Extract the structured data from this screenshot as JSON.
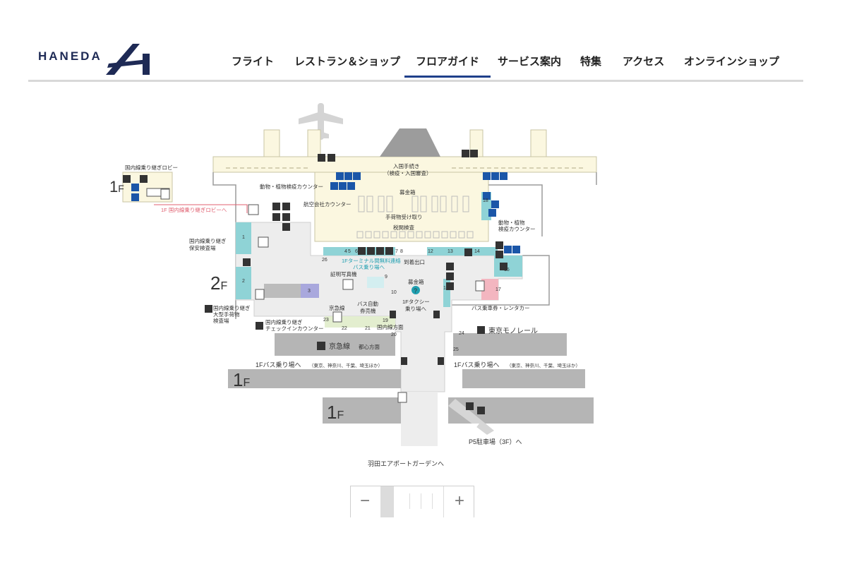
{
  "header": {
    "logo_text": "HANEDA",
    "nav": [
      "フライト",
      "レストラン＆ショップ",
      "フロアガイド",
      "サービス案内",
      "特集",
      "アクセス",
      "オンラインショップ"
    ],
    "active_index": 2
  },
  "map": {
    "floor_labels": {
      "f1_top": "1",
      "f2": "2",
      "f1_left": "1",
      "f1_bottom": "1",
      "suffix": "F"
    },
    "labels": {
      "transfer_lobby": "国内線乗り継ぎロビー",
      "transfer_lobby_link": "1F 国内線乗り継ぎロビーへ",
      "immigration": "入国手続き",
      "immigration_sub": "（検疫・入国審査）",
      "plant_quarantine_left": "動物・植物検疫カウンター",
      "donation_box_top": "募金箱",
      "airline_counter": "航空会社カウンター",
      "baggage_claim": "手荷物受け取り",
      "customs": "税関検査",
      "plant_quarantine_right_1": "動物・植物",
      "plant_quarantine_right_2": "検疫カウンター",
      "transfer_security_1": "国内線乗り継ぎ",
      "transfer_security_2": "保安検査場",
      "bus_connection_1": "1Fターミナル間無料連絡",
      "bus_connection_2": "バス乗り場へ",
      "arrival_exit": "到着出口",
      "id_photo": "証明写真機",
      "donation_box_mid": "募金箱",
      "bus_ticket_1": "バス自動",
      "bus_ticket_2": "券売機",
      "taxi_1": "1Fタクシー",
      "taxi_2": "乗り場へ",
      "bus_rental": "バス乗車券・レンタカー",
      "keikyu_small": "京急線",
      "domestic_direction": "国内線方面",
      "monorail": "東京モノレール",
      "large_baggage_1": "国内線乗り継ぎ",
      "large_baggage_2": "大型手荷物",
      "large_baggage_3": "検査場",
      "checkin_1": "国内線乗り継ぎ",
      "checkin_2": "チェックインカウンター",
      "keikyu": "京急線",
      "city_center": "都心方面",
      "bus_left": "1Fバス乗り場へ",
      "bus_right": "1Fバス乗り場へ",
      "bus_areas": "（東京、神奈川、千葉、埼玉ほか）",
      "parking": "P5駐車場（3F）へ",
      "garden": "羽田エアポートガーデンへ"
    },
    "numbers": [
      "1",
      "2",
      "3",
      "4",
      "5",
      "6",
      "7",
      "8",
      "9",
      "10",
      "12",
      "13",
      "14",
      "15",
      "16",
      "17",
      "18",
      "19",
      "20",
      "21",
      "22",
      "23",
      "24",
      "25",
      "26"
    ]
  },
  "zoom": {
    "minus": "−",
    "plus": "+"
  },
  "colors": {
    "navy": "#1e2a55",
    "accent": "#1f3f8a",
    "teal": "#8fd3d6",
    "pink": "#f3b6c0",
    "purple": "#a9a8dd",
    "beige": "#fbf7e0",
    "gray_band": "#b5b5b5",
    "icon_blue": "#1b56a8"
  }
}
